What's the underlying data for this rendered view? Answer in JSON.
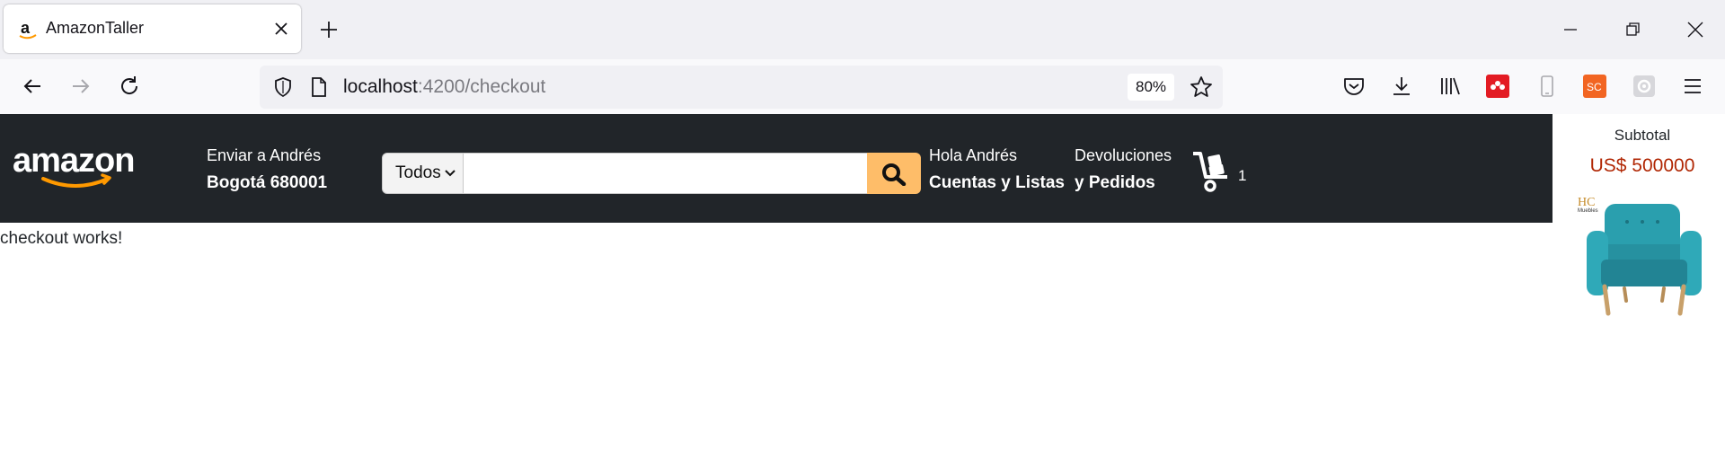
{
  "browser": {
    "tab_title": "AmazonTaller",
    "url_host": "localhost",
    "url_rest": ":4200/checkout",
    "zoom": "80%"
  },
  "header": {
    "logo_text": "amazon",
    "deliver_line1": "Enviar a Andrés",
    "deliver_line2": "Bogotá 680001",
    "search_category": "Todos",
    "search_value": "",
    "account_line1": "Hola Andrés",
    "account_line2": "Cuentas y Listas",
    "returns_line1": "Devoluciones",
    "returns_line2": "y Pedidos",
    "cart_count": "1"
  },
  "main": {
    "message": "checkout works!"
  },
  "side_panel": {
    "label": "Subtotal",
    "price": "US$ 500000",
    "brand_logo_text": "HC Muebles"
  },
  "colors": {
    "header_bg": "#212529",
    "search_button": "#febd69",
    "price": "#b12704",
    "logo_smile": "#ff9900"
  }
}
